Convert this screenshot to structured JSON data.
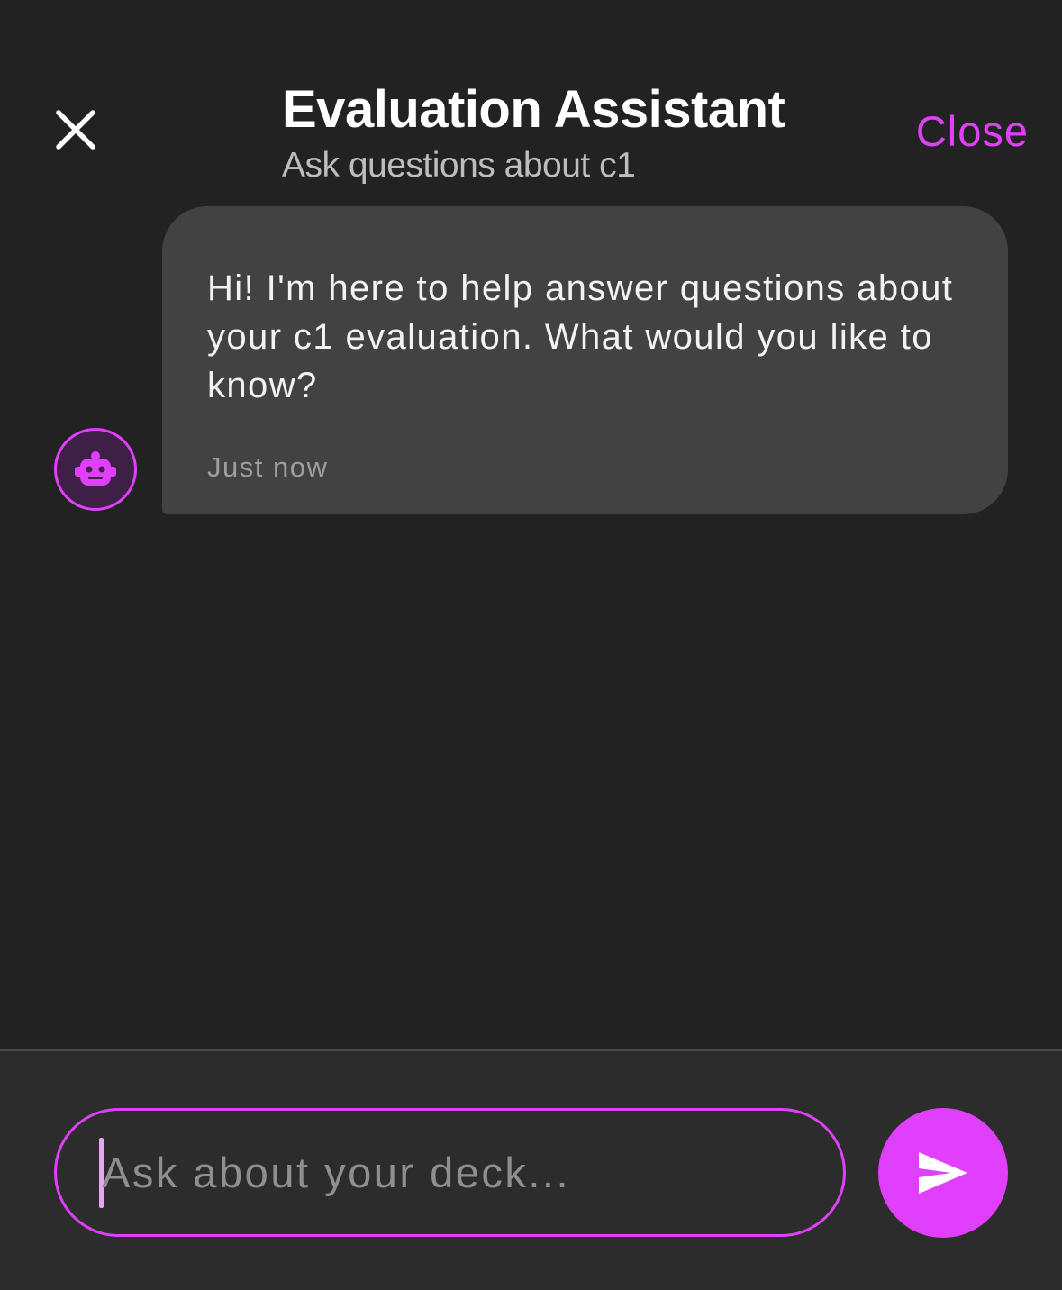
{
  "header": {
    "title": "Evaluation Assistant",
    "subtitle": "Ask questions about c1",
    "close_label": "Close",
    "close_icon": "close-icon"
  },
  "messages": [
    {
      "sender": "assistant",
      "avatar_icon": "robot-icon",
      "text": "Hi! I'm here to help answer questions about your c1 evaluation. What would you like to know?",
      "time": "Just now"
    }
  ],
  "composer": {
    "placeholder": "Ask about your deck...",
    "value": "",
    "send_icon": "send-icon"
  },
  "colors": {
    "background": "#222222",
    "accent": "#e040fb",
    "bubble": "#424242",
    "input_bar": "#2c2c2c"
  }
}
